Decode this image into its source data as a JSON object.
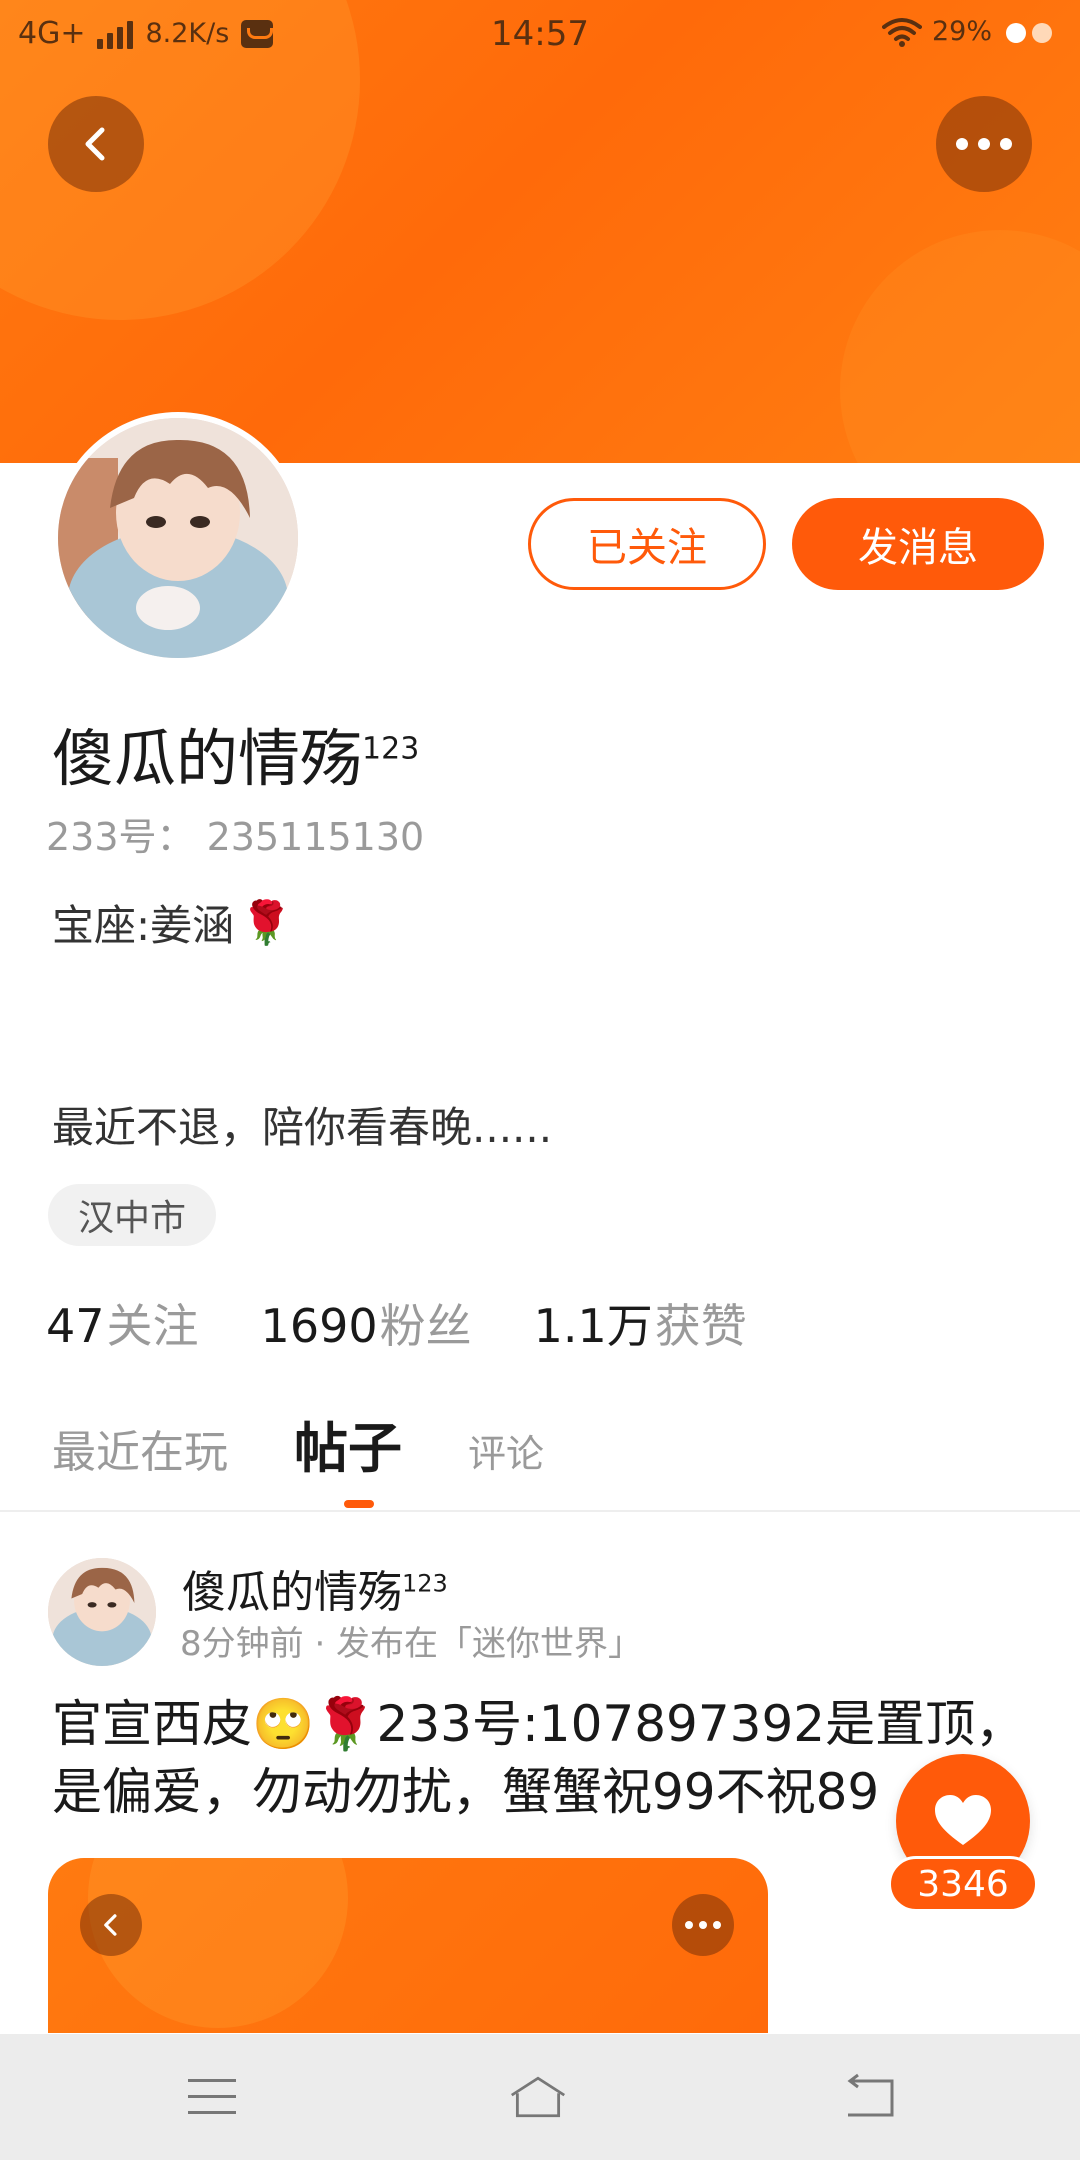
{
  "status_bar": {
    "network": "4G+",
    "speed": "8.2K/s",
    "time": "14:57",
    "battery": "29%"
  },
  "header": {
    "back_icon": "chevron-left-icon",
    "more_icon": "more-dots-icon"
  },
  "profile": {
    "follow_button": "已关注",
    "message_button": "发消息",
    "name": "傻瓜的情殇",
    "name_sup": "123",
    "uid": "233号： 235115130",
    "bio_line1": "宝座:姜涵",
    "bio_line1_emoji": "🌹",
    "bio_line2": "最近不退，陪你看春晚......",
    "location": "汉中市",
    "stats": [
      {
        "num": "47",
        "label": "关注"
      },
      {
        "num": "1690",
        "label": "粉丝"
      },
      {
        "num": "1.1万",
        "label": "获赞"
      }
    ]
  },
  "tabs": [
    {
      "label": "最近在玩",
      "active": false
    },
    {
      "label": "帖子",
      "active": true
    },
    {
      "label": "评论",
      "active": false
    }
  ],
  "post": {
    "author": "傻瓜的情殇",
    "author_sup": "123",
    "meta": "8分钟前 · 发布在「迷你世界」",
    "text_line1": "官宣西皮🙄🌹233号:107897392是置顶，",
    "text_line2": "是偏爱，勿动勿扰，蟹蟹祝99不祝89"
  },
  "like": {
    "count": "3346"
  },
  "colors": {
    "accent": "#ff5a0a",
    "banner": "#ff7a10"
  },
  "nav_bar": {
    "menu_icon": "menu-icon",
    "home_icon": "home-icon",
    "back_icon": "back-arrow-icon"
  }
}
